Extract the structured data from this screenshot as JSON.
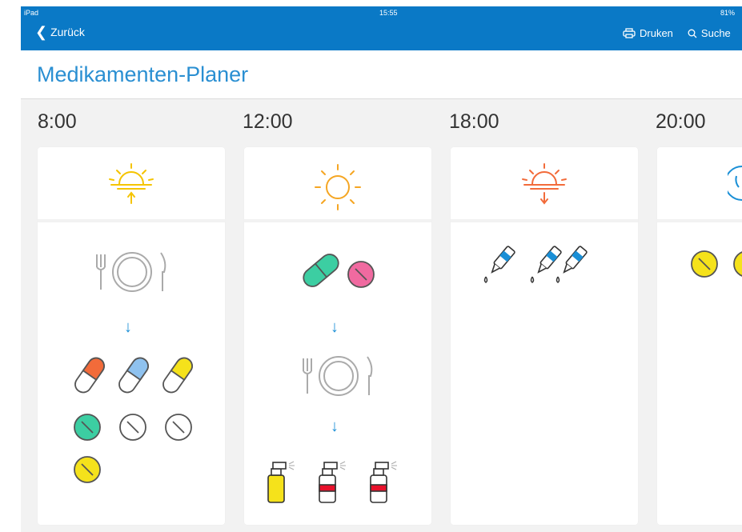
{
  "status": {
    "device": "iPad",
    "time": "15:55",
    "battery": "81%"
  },
  "nav": {
    "back_label": "Zurück",
    "print_label": "Druken",
    "search_label": "Suche"
  },
  "page": {
    "title": "Medikamenten-Planer"
  },
  "schedule": [
    {
      "time": "8:00",
      "period_icon": "sunrise-icon",
      "color": "#f5c400",
      "sequence": [
        "meal",
        "then-arrow",
        "medication"
      ],
      "medication": [
        "capsule-orange",
        "capsule-blue",
        "capsule-yellow",
        "tablet-teal",
        "tablet-white",
        "tablet-white",
        "tablet-yellow"
      ]
    },
    {
      "time": "12:00",
      "period_icon": "sun-icon",
      "color": "#f5a623",
      "sequence": [
        "medication",
        "then-arrow",
        "meal",
        "then-arrow",
        "spray"
      ],
      "medication": [
        "capsule-teal",
        "tablet-pink",
        "spray-yellow",
        "spray-red",
        "spray-red"
      ]
    },
    {
      "time": "18:00",
      "period_icon": "sunset-icon",
      "color": "#f26b3a",
      "medication": [
        "dropper-blue",
        "dropper-blue",
        "dropper-blue"
      ]
    },
    {
      "time": "20:00",
      "period_icon": "moon-icon",
      "color": "#1a8fd6",
      "medication": [
        "tablet-yellow",
        "tablet-yellow"
      ]
    }
  ],
  "colors": {
    "accent": "#0a79c6",
    "title": "#2a8fd2",
    "arrow": "#1a8fd6"
  }
}
